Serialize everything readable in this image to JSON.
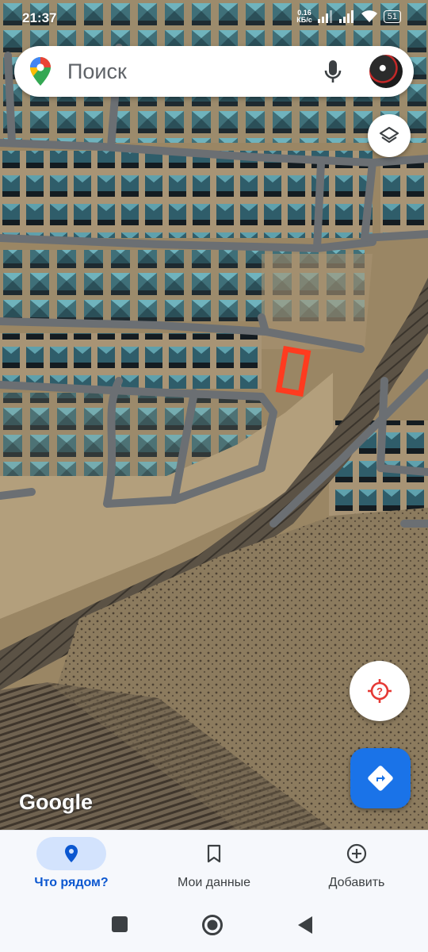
{
  "status_bar": {
    "time": "21:37",
    "net_speed_value": "0.16",
    "net_speed_unit": "КБ/с",
    "battery": "51"
  },
  "search": {
    "placeholder": "Поиск"
  },
  "map": {
    "attribution": "Google",
    "type": "satellite"
  },
  "bottom_nav": {
    "tabs": [
      {
        "label": "Что рядом?",
        "icon": "location-pin-icon",
        "active": true
      },
      {
        "label": "Мои данные",
        "icon": "bookmark-icon",
        "active": false
      },
      {
        "label": "Добавить",
        "icon": "add-circle-icon",
        "active": false
      }
    ]
  },
  "colors": {
    "accent": "#1a73e8",
    "active_tab": "#0b57d0",
    "active_pill": "#d3e3fd",
    "marker": "#ff3b1f",
    "location_icon": "#e53935"
  }
}
